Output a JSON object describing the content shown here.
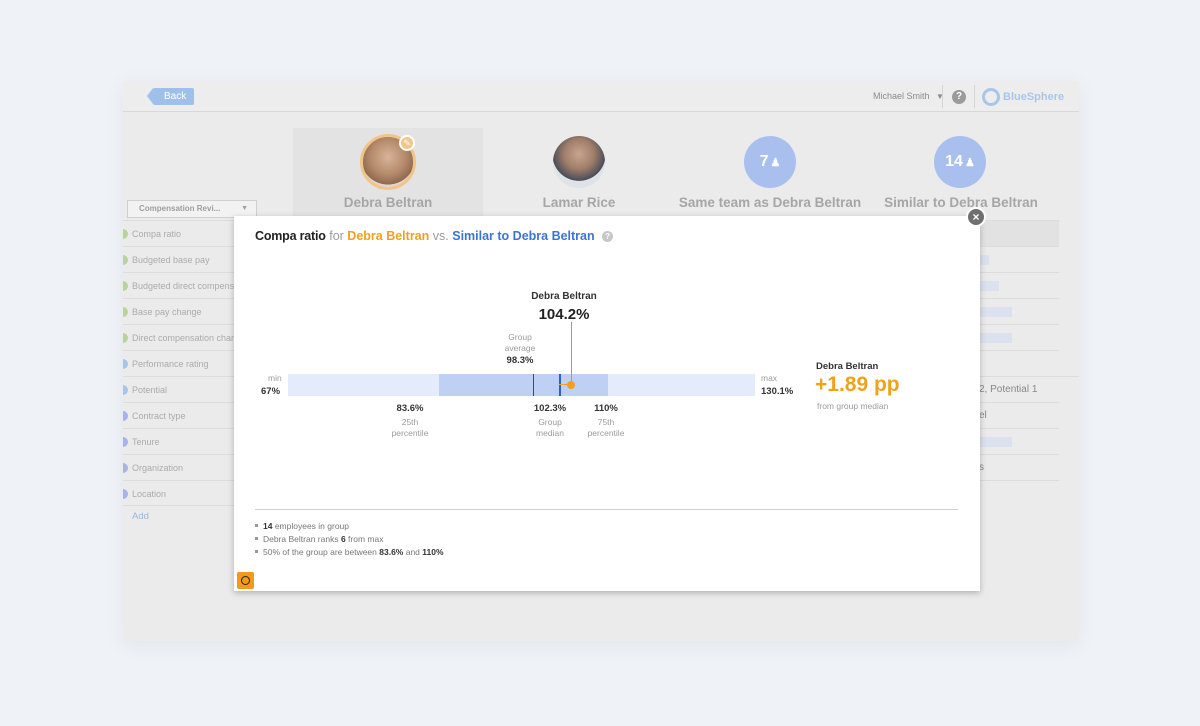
{
  "topbar": {
    "back_label": "Back",
    "user_name": "Michael Smith",
    "user_caret": "▼",
    "help_glyph": "?",
    "brand_name": "BlueSphere"
  },
  "columns": [
    {
      "name": "Debra Beltran",
      "kind": "photo"
    },
    {
      "name": "Lamar Rice",
      "kind": "photo"
    },
    {
      "name": "Same team as Debra Beltran",
      "kind": "group",
      "count": "7"
    },
    {
      "name": "Similar to Debra Beltran",
      "kind": "group",
      "count": "14"
    }
  ],
  "sidebar": {
    "dropdown_label": "Compensation Revi...",
    "dropdown_caret": "▼",
    "metrics": [
      "Compa ratio",
      "Budgeted base pay",
      "Budgeted direct compensation",
      "Base pay change",
      "Direct compensation change",
      "Performance rating",
      "Potential",
      "Contract type",
      "Tenure",
      "Organization",
      "Location"
    ],
    "add_label": "Add"
  },
  "background_table": {
    "potential_text": "2, Potential 1",
    "contract_text": "el",
    "tenure_text": "s"
  },
  "modal": {
    "title": {
      "metric": "Compa ratio",
      "for": "for",
      "person": "Debra Beltran",
      "vs": "vs.",
      "group": "Similar to Debra Beltran",
      "help": "?"
    },
    "close_glyph": "×",
    "highlight_name": "Debra Beltran",
    "highlight_value": "104.2%",
    "group_average_label": [
      "Group",
      "average"
    ],
    "group_average_value": "98.3%",
    "min_label": "min",
    "min_value": "67%",
    "max_label": "max",
    "max_value": "130.1%",
    "p25_value": "83.6%",
    "p25_label": [
      "25th",
      "percentile"
    ],
    "median_value": "102.3%",
    "median_label": [
      "Group",
      "median"
    ],
    "p75_value": "110%",
    "p75_label": [
      "75th",
      "percentile"
    ],
    "diff_name": "Debra Beltran",
    "diff_value": "+1.89 pp",
    "diff_caption": "from group median",
    "notes": [
      {
        "bold": "14",
        "text": " employees in group"
      },
      {
        "pre": "Debra Beltran ranks ",
        "bold": "6",
        "text": " from max"
      },
      {
        "pre": "50% of the group are between ",
        "bold": "83.6%",
        "mid": " and ",
        "bold2": "110%"
      }
    ],
    "distribution": {
      "min": 67,
      "p25": 83.6,
      "median": 102.3,
      "average": 98.3,
      "p75": 110,
      "max": 130.1,
      "person": 104.2
    },
    "colors": {
      "accent": "#f2a11d",
      "blue": "#3b73d8",
      "bar_light": "#e4ecfb",
      "bar_iqr": "#bed1f5"
    }
  }
}
